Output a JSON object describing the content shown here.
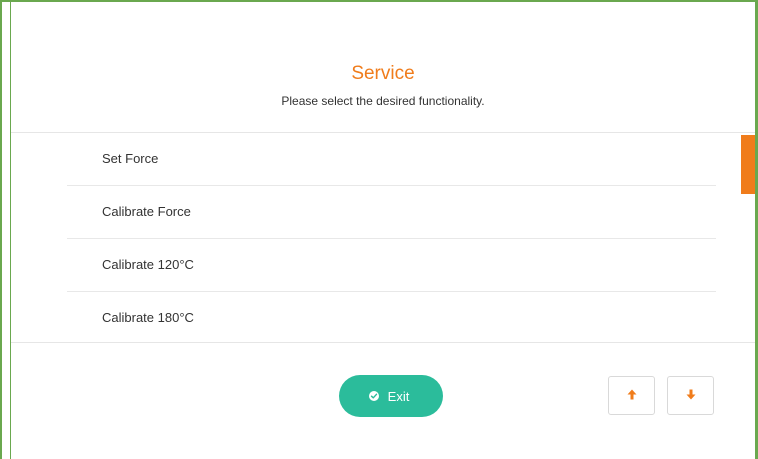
{
  "header": {
    "title": "Service",
    "subtitle": "Please select the desired functionality."
  },
  "menu": {
    "items": [
      {
        "label": "Set Force"
      },
      {
        "label": "Calibrate Force"
      },
      {
        "label": "Calibrate 120°C"
      },
      {
        "label": "Calibrate 180°C"
      }
    ]
  },
  "footer": {
    "exit_label": "Exit",
    "exit_icon": "check-circle-icon",
    "up_icon": "arrow-up-icon",
    "down_icon": "arrow-down-icon"
  },
  "colors": {
    "accent": "#f07c1b",
    "exit_button": "#2bbc9b",
    "frame_border": "#6aa84f"
  }
}
